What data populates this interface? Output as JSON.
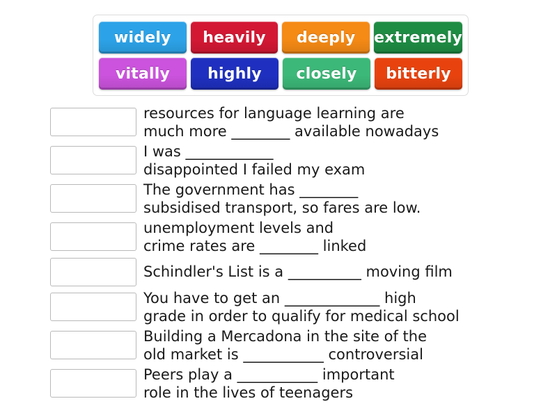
{
  "tile_bank": {
    "name": "word-bank",
    "rows": [
      [
        {
          "label": "widely",
          "color": "#2ca3e8"
        },
        {
          "label": "heavily",
          "color": "#d31834"
        },
        {
          "label": "deeply",
          "color": "#f58a15"
        },
        {
          "label": "extremely",
          "color": "#1e8c43"
        }
      ],
      [
        {
          "label": "vitally",
          "color": "#cb53dd"
        },
        {
          "label": "highly",
          "color": "#1f30c0"
        },
        {
          "label": "closely",
          "color": "#3cb878"
        },
        {
          "label": "bitterly",
          "color": "#e8430f"
        }
      ]
    ]
  },
  "questions": [
    {
      "lines": "resources for language learning are\nmuch more ________ available nowadays",
      "two_line": true,
      "answer": ""
    },
    {
      "lines": "I was ____________\ndisappointed I failed my exam",
      "two_line": true,
      "answer": ""
    },
    {
      "lines": "The government has ________\nsubsidised transport, so fares are low.",
      "two_line": true,
      "answer": ""
    },
    {
      "lines": "unemployment levels and\ncrime rates are ________ linked",
      "two_line": true,
      "answer": ""
    },
    {
      "lines": "Schindler's List is a __________ moving film",
      "two_line": false,
      "answer": ""
    },
    {
      "lines": "You have to get an _____________ high\ngrade in order to qualify for medical school",
      "two_line": true,
      "answer": ""
    },
    {
      "lines": "Building a Mercadona in the site of the\nold market is ___________ controversial",
      "two_line": true,
      "answer": ""
    },
    {
      "lines": "Peers play a ___________ important\nrole in the lives of teenagers",
      "two_line": true,
      "answer": ""
    }
  ]
}
